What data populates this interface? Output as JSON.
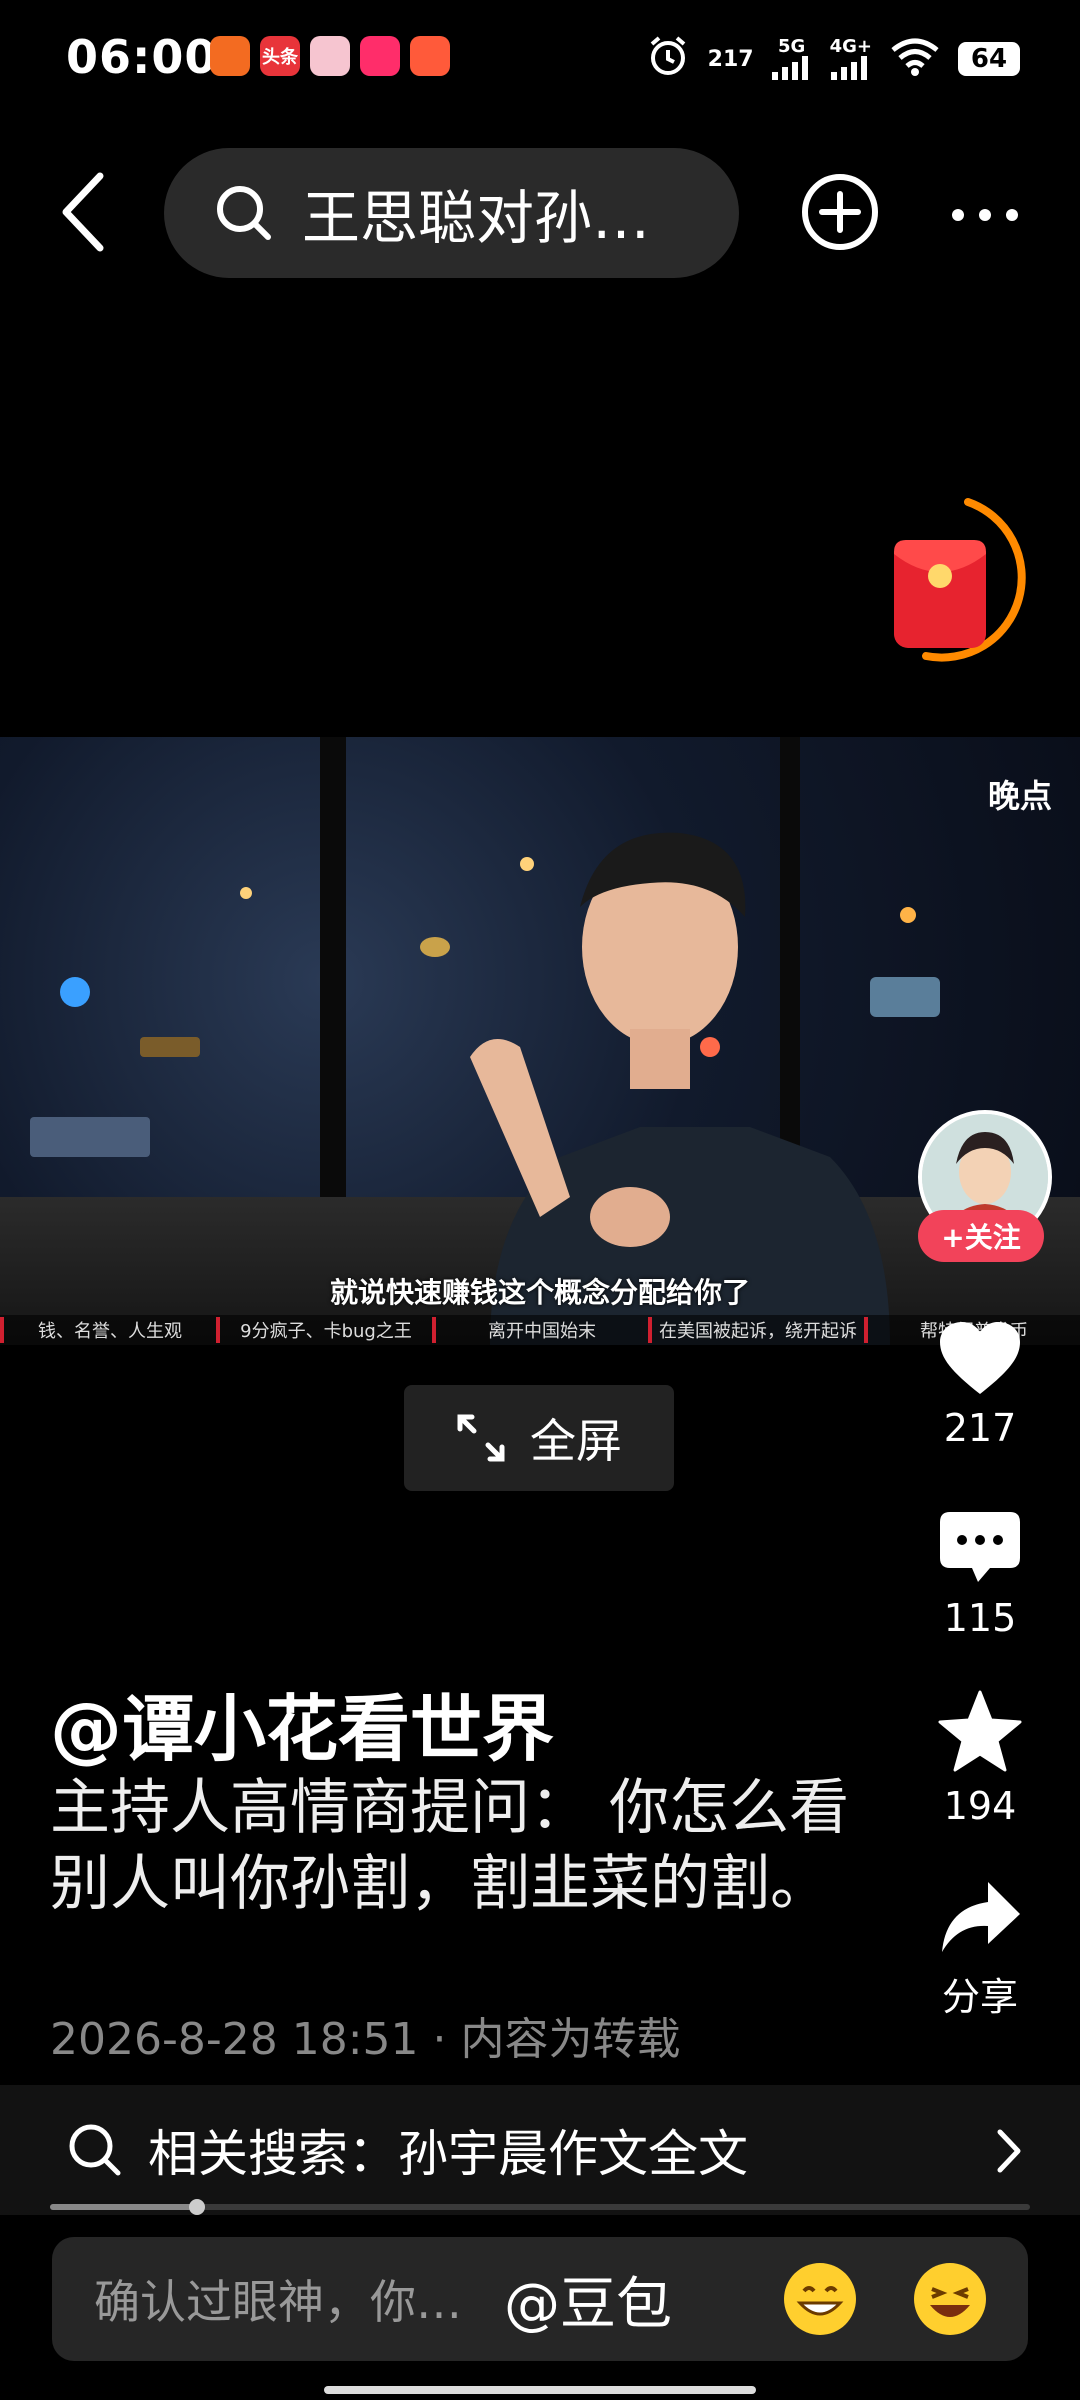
{
  "status_bar": {
    "time": "06:00",
    "app_icons": [
      {
        "name": "fly-app-icon",
        "color": "#f36b21",
        "label": ""
      },
      {
        "name": "toutiao-app-icon",
        "color": "#e8343a",
        "label": "头条"
      },
      {
        "name": "pink-app-icon",
        "color": "#f6c5d0",
        "label": ""
      },
      {
        "name": "douyin-app-icon",
        "color": "#ff2d6a",
        "label": ""
      },
      {
        "name": "cartoon-app-icon",
        "color": "#ff5a3a",
        "label": ""
      }
    ],
    "signal_badge": "217",
    "net1": "5G",
    "net2": "4G+",
    "battery": "64"
  },
  "header": {
    "search_query": "王思聪对孙…"
  },
  "video": {
    "watermark": "晚点",
    "subtitle": "就说快速赚钱这个概念分配给你了",
    "chapters": [
      "钱、名誉、人生观",
      "9分疯子、卡bug之王",
      "离开中国始末",
      "在美国被起诉，绕开起诉",
      "帮特朗普发币"
    ]
  },
  "creator": {
    "follow_label": "+关注"
  },
  "actions": {
    "likes": "217",
    "comments": "115",
    "favorites": "194",
    "share": "分享"
  },
  "fullscreen_label": "全屏",
  "post": {
    "author": "@谭小花看世界",
    "description": "主持人高情商提问： 你怎么看别人叫你孙割，割韭菜的割。",
    "meta": "2026-8-28 18:51 · 内容为转载"
  },
  "related_search": {
    "text": "相关搜索：孙宇晨作文全文"
  },
  "playback_progress": 0.15,
  "comment_bar": {
    "placeholder": "确认过眼神，你…",
    "mention": "@豆包"
  },
  "colors": {
    "accent_red": "#f2435a",
    "redpack_ring": "#ff8a00"
  }
}
